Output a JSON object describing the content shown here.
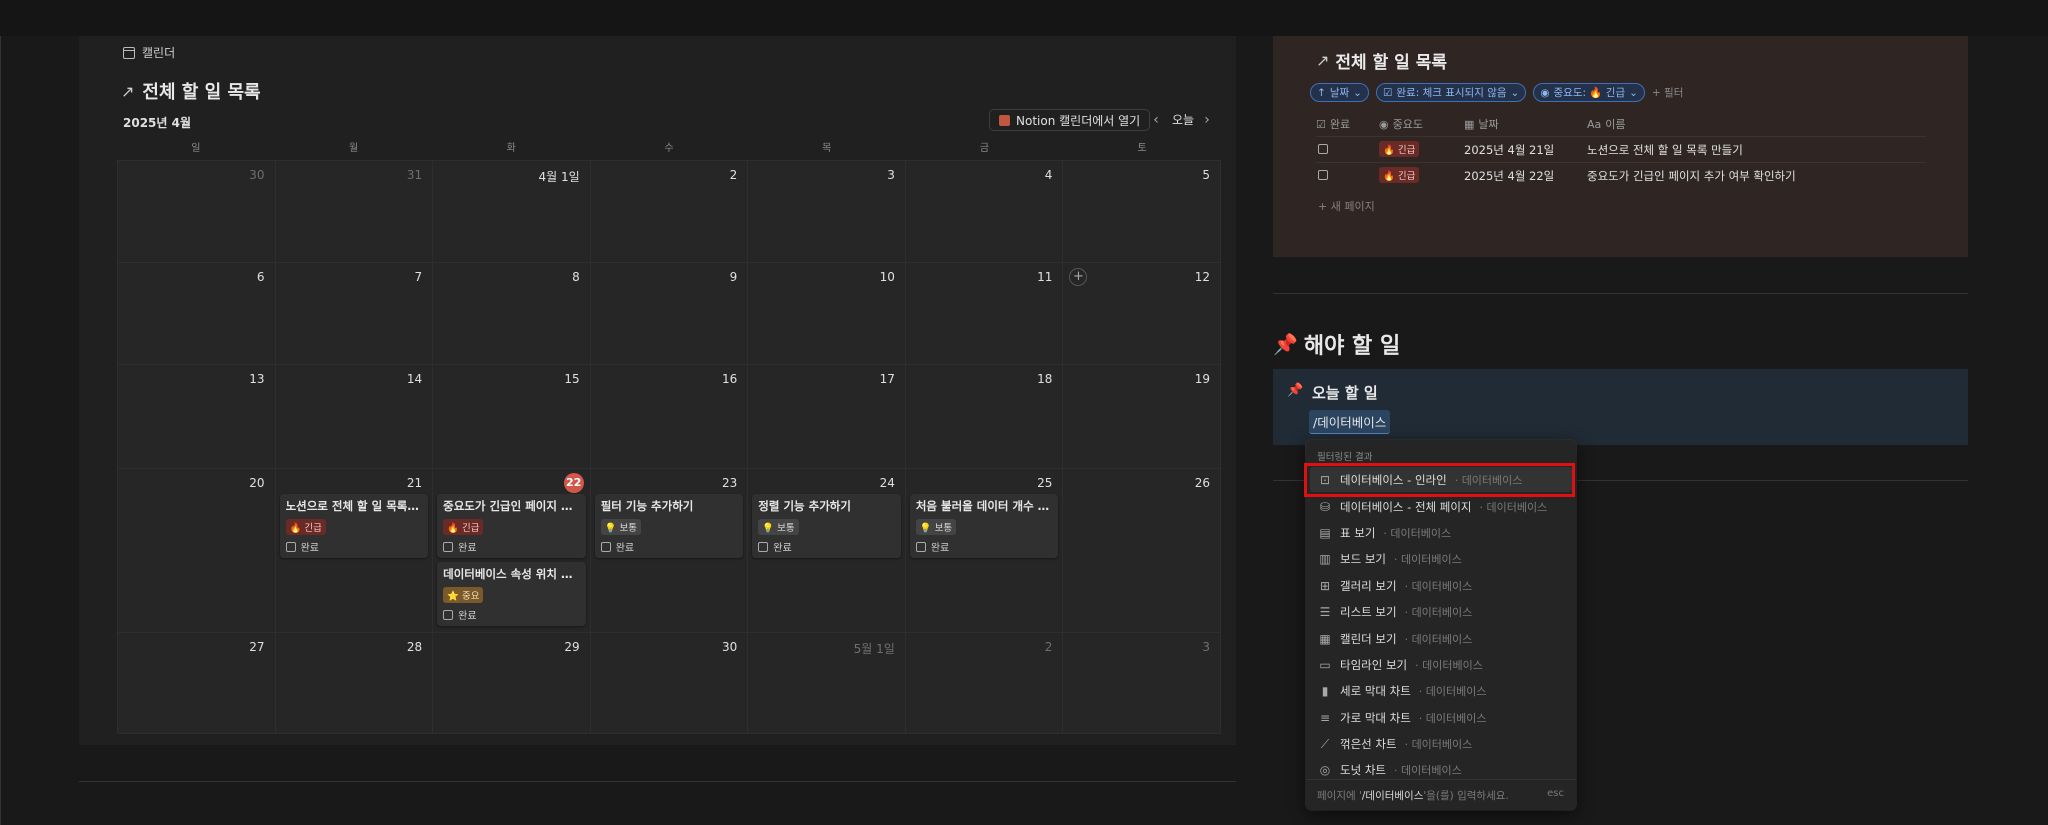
{
  "calendar": {
    "view_tab": "캘린더",
    "title": "전체 할 일 목록",
    "month": "2025년 4월",
    "open_button": "Notion 캘린더에서 열기",
    "today": "오늘",
    "weekdays": [
      "일",
      "월",
      "화",
      "수",
      "목",
      "금",
      "토"
    ],
    "weeks": [
      [
        "30",
        "31",
        "4월 1일",
        "2",
        "3",
        "4",
        "5"
      ],
      [
        "6",
        "7",
        "8",
        "9",
        "10",
        "11",
        "12"
      ],
      [
        "13",
        "14",
        "15",
        "16",
        "17",
        "18",
        "19"
      ],
      [
        "20",
        "21",
        "22",
        "23",
        "24",
        "25",
        "26"
      ],
      [
        "27",
        "28",
        "29",
        "30",
        "5월 1일",
        "2",
        "3"
      ]
    ],
    "events": [
      {
        "title": "노션으로 전체 할 일 목록 만...",
        "tag": "🔥 긴급",
        "done": "완료"
      },
      {
        "title": "중요도가 긴급인 페이지 추...",
        "tag": "🔥 긴급",
        "done": "완료"
      },
      {
        "title": "데이터베이스 속성 위치 변...",
        "tag": "⭐ 중요",
        "done": "완료"
      },
      {
        "title": "필터 기능 추가하기",
        "tag": "💡 보통",
        "done": "완료"
      },
      {
        "title": "정렬 기능 추가하기",
        "tag": "💡 보통",
        "done": "완료"
      },
      {
        "title": "처음 불러올 데이터 개수 지...",
        "tag": "💡 보통",
        "done": "완료"
      }
    ]
  },
  "db": {
    "title": "전체 할 일 목록",
    "filters": [
      "날짜",
      "완료: 체크 표시되지 않음",
      "중요도: 🔥 긴급"
    ],
    "add_filter": "+ 필터",
    "columns": [
      "완료",
      "중요도",
      "날짜",
      "이름"
    ],
    "rows": [
      {
        "priority": "🔥 긴급",
        "date": "2025년 4월 21일",
        "name": "노션으로 전체 할 일 목록 만들기"
      },
      {
        "priority": "🔥 긴급",
        "date": "2025년 4월 22일",
        "name": "중요도가 긴급인 페이지 추가 여부 확인하기"
      }
    ],
    "new_page": "+ 새 페이지"
  },
  "section": {
    "heading": "해야 할 일",
    "callout_title": "오늘 할 일",
    "input_value": "/데이터베이스"
  },
  "slash_menu": {
    "header": "필터링된 결과",
    "items": [
      {
        "label": "데이터베이스 - 인라인",
        "sub": "데이터베이스",
        "icon": "inline-db-icon"
      },
      {
        "label": "데이터베이스 - 전체 페이지",
        "sub": "데이터베이스",
        "icon": "database-icon"
      },
      {
        "label": "표 보기",
        "sub": "데이터베이스",
        "icon": "table-icon"
      },
      {
        "label": "보드 보기",
        "sub": "데이터베이스",
        "icon": "board-icon"
      },
      {
        "label": "갤러리 보기",
        "sub": "데이터베이스",
        "icon": "gallery-icon"
      },
      {
        "label": "리스트 보기",
        "sub": "데이터베이스",
        "icon": "list-icon"
      },
      {
        "label": "캘린더 보기",
        "sub": "데이터베이스",
        "icon": "calendar-icon"
      },
      {
        "label": "타임라인 보기",
        "sub": "데이터베이스",
        "icon": "timeline-icon"
      },
      {
        "label": "세로 막대 차트",
        "sub": "데이터베이스",
        "icon": "bar-chart-icon"
      },
      {
        "label": "가로 막대 차트",
        "sub": "데이터베이스",
        "icon": "hbar-chart-icon"
      },
      {
        "label": "꺾은선 차트",
        "sub": "데이터베이스",
        "icon": "line-chart-icon"
      },
      {
        "label": "도넛 차트",
        "sub": "데이터베이스",
        "icon": "donut-chart-icon"
      }
    ],
    "footer_prefix": "페이지에",
    "footer_value": "/데이터베이스",
    "footer_suffix": "'을(를) 입력하세요.",
    "esc": "esc"
  }
}
